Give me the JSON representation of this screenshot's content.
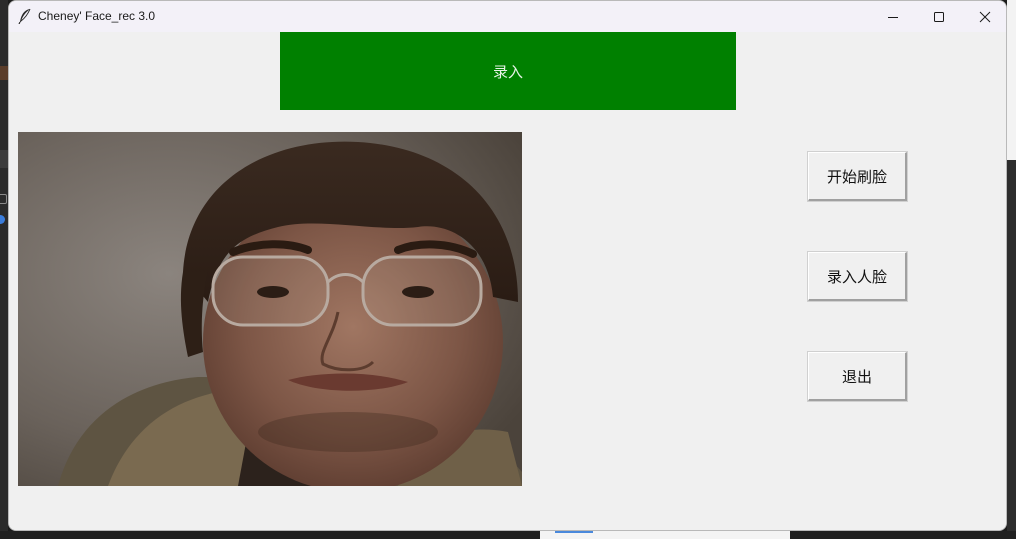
{
  "window": {
    "title": "Cheney' Face_rec 3.0",
    "controls": [
      "minimize",
      "maximize",
      "close"
    ]
  },
  "banner": {
    "label": "录入",
    "color": "#008000"
  },
  "camera": {
    "description_icon": "camera-feed"
  },
  "buttons": {
    "start_label": "开始刷脸",
    "enroll_label": "录入人脸",
    "exit_label": "退出"
  }
}
